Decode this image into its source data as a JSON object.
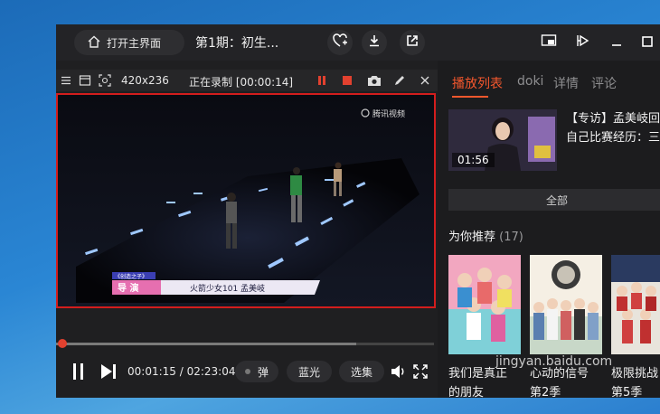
{
  "titlebar": {
    "home_label": "打开主界面",
    "episode_title": "第1期：初生..."
  },
  "recorder": {
    "resolution": "420x236",
    "status": "正在录制 [00:00:14]"
  },
  "video": {
    "logo_text": "腾讯视频",
    "caption_tag": "《创造之子》",
    "caption_role": "导   演",
    "caption_name": "火箭少女101 孟美岐"
  },
  "player": {
    "time_display": "00:01:15 / 02:23:04",
    "danmu_label": "弹",
    "quality_label": "蓝光",
    "episodes_label": "选集",
    "progress_fraction": 0.009
  },
  "panel": {
    "tabs": [
      "播放列表",
      "doki",
      "详情",
      "评论"
    ],
    "episode": {
      "duration": "01:56",
      "title_line1": "【专访】孟美岐回",
      "title_line2": "自己比赛经历：三"
    },
    "all_label": "全部",
    "recommend_heading": "为你推荐",
    "recommend_count": "(17)",
    "recommendations": [
      {
        "line1": "我们是真正",
        "line2": "的朋友"
      },
      {
        "line1": "心动的信号",
        "line2": "第2季"
      },
      {
        "line1": "极限挑战",
        "line2": "第5季"
      }
    ]
  },
  "watermark": "jingyan.baidu.com",
  "colors": {
    "accent": "#f4572d",
    "record_red": "#e2412f",
    "highlight_border": "#d31d1d"
  }
}
